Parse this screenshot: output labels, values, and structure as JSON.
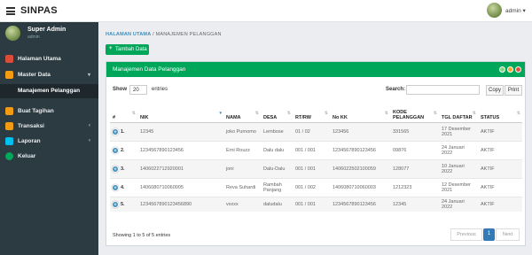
{
  "app": {
    "brand": "SINPAS"
  },
  "topbar": {
    "user": "admin ▾"
  },
  "sidebar": {
    "user_name": "Super Admin",
    "user_role": "admin",
    "items": [
      {
        "label": "Halaman Utama",
        "icon": "home-icon",
        "color": "#dd4b39",
        "caret": ""
      },
      {
        "label": "Master Data",
        "icon": "folder-icon",
        "color": "#f39c12",
        "caret": "▾"
      },
      {
        "label": "Buat Tagihan",
        "icon": "file-icon",
        "color": "#f39c12",
        "caret": ""
      },
      {
        "label": "Transaksi",
        "icon": "transaction-icon",
        "color": "#f39c12",
        "caret": "‹"
      },
      {
        "label": "Laporan",
        "icon": "report-icon",
        "color": "#00c0ef",
        "caret": "‹"
      },
      {
        "label": "Keluar",
        "icon": "logout-icon",
        "color": "#00a65a",
        "caret": ""
      }
    ],
    "active_sub": "Manajemen Pelanggan"
  },
  "breadcrumb": {
    "home": "HALAMAN UTAMA",
    "sep": "/",
    "current": "MANAJEMEN PELANGGAN"
  },
  "add_button": "Tambah Data",
  "panel": {
    "title": "Manajemen Data Pelanggan"
  },
  "table_controls": {
    "show": "Show",
    "entries_value": "20",
    "entries": "entries",
    "search": "Search:",
    "copy": "Copy",
    "print": "Print"
  },
  "columns": [
    "#",
    "NIK",
    "NAMA",
    "DESA",
    "RT/RW",
    "No KK",
    "KODE PELANGGAN",
    "TGL DAFTAR",
    "STATUS"
  ],
  "rows": [
    {
      "no": "1.",
      "nik": "12345",
      "nama": "joko Purnomo",
      "desa": "Lembose",
      "rtrw": "01 / 02",
      "kk": "123456",
      "kode": "331565",
      "tgl": "17 Desember 2021",
      "status": "AKTIF"
    },
    {
      "no": "2.",
      "nik": "1234567890123456",
      "nama": "Erni Rouzz",
      "desa": "Dalu dalu",
      "rtrw": "001 / 001",
      "kk": "1234567890123456",
      "kode": "09876",
      "tgl": "24 Januari 2022",
      "status": "AKTIF"
    },
    {
      "no": "3.",
      "nik": "1406022712920001",
      "nama": "joni",
      "desa": "Dalu-Dalu",
      "rtrw": "001 / 001",
      "kk": "1406022502100059",
      "kode": "128077",
      "tgl": "10 Januari 2022",
      "status": "AKTIF"
    },
    {
      "no": "4.",
      "nik": "1406080710060005",
      "nama": "Reva Suhardi",
      "desa": "Rambah Panjang",
      "rtrw": "001 / 002",
      "kk": "1406080710060003",
      "kode": "1212323",
      "tgl": "12 Desember 2021",
      "status": "AKTIF"
    },
    {
      "no": "5.",
      "nik": "1234567890123456890",
      "nama": "vxxxx",
      "desa": "daludalu",
      "rtrw": "001 / 001",
      "kk": "1234567890123456",
      "kode": "12345",
      "tgl": "24 Januari 2022",
      "status": "AKTIF"
    }
  ],
  "footer": {
    "info": "Showing 1 to 5 of 5 entries",
    "prev": "Previous",
    "page": "1",
    "next": "Next"
  }
}
